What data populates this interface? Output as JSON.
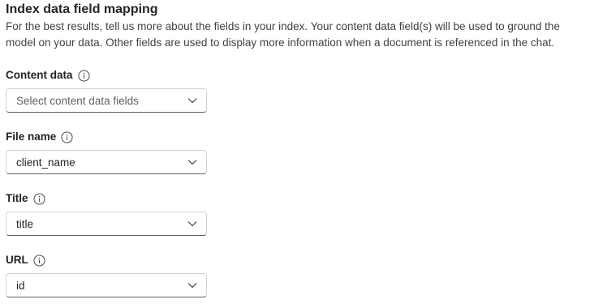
{
  "section": {
    "title": "Index data field mapping",
    "description_line1": "For the best results, tell us more about the fields in your index. Your content data field(s) will be used to ground the",
    "description_line2": "model on your data. Other fields are used to display more information when a document is referenced in the chat."
  },
  "fields": [
    {
      "label": "Content data",
      "value": "",
      "placeholder": "Select content data fields"
    },
    {
      "label": "File name",
      "value": "client_name",
      "placeholder": ""
    },
    {
      "label": "Title",
      "value": "title",
      "placeholder": ""
    },
    {
      "label": "URL",
      "value": "id",
      "placeholder": ""
    }
  ],
  "icons": {
    "info": "info-icon",
    "chevron": "chevron-down-icon"
  },
  "colors": {
    "text": "#242424",
    "muted": "#616161",
    "border": "#d1d1d1"
  }
}
